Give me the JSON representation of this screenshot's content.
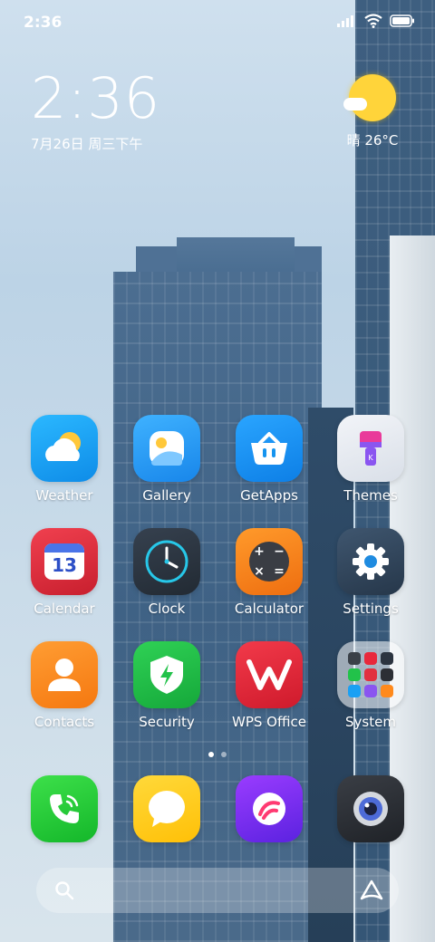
{
  "status_bar": {
    "time": "2:36"
  },
  "clock_widget": {
    "time": "2:36",
    "date": "7月26日 周三下午"
  },
  "weather_widget": {
    "icon": "sun-cloud-icon",
    "text": "晴 26°C"
  },
  "apps": {
    "weather": "Weather",
    "gallery": "Gallery",
    "getapps": "GetApps",
    "themes": "Themes",
    "calendar": "Calendar",
    "calendar_day": "13",
    "clock": "Clock",
    "calculator": "Calculator",
    "settings": "Settings",
    "contacts": "Contacts",
    "security": "Security",
    "wps": "WPS Office",
    "system": "System"
  },
  "page_indicator": {
    "pages": 2,
    "active": 1
  },
  "colors": {
    "weather": "#1aa0f4",
    "gallery": "#1e9cf2",
    "getapps": "#1594ef",
    "themes": "#e6ebf2",
    "calendar": "#e1303f",
    "clock": "#2b3440",
    "calculator": "#f5801e",
    "settings": "#34485e",
    "contacts": "#ff8a1c",
    "security": "#22c24a",
    "wps": "#e8283b",
    "phone": "#2dd23b",
    "messages": "#ffcf1a",
    "browser": "#7b2ff2",
    "camera": "#2c2f35"
  }
}
